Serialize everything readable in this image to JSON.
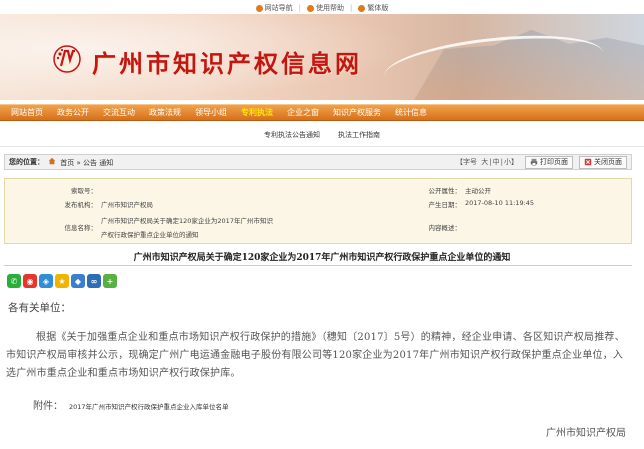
{
  "toplinks": [
    {
      "label": "网站导航"
    },
    {
      "label": "使用帮助"
    },
    {
      "label": "繁体版"
    }
  ],
  "site": {
    "title": "广州市知识产权信息网"
  },
  "nav": {
    "items": [
      {
        "label": "网站首页"
      },
      {
        "label": "政务公开"
      },
      {
        "label": "交流互动"
      },
      {
        "label": "政策法规"
      },
      {
        "label": "领导小组"
      },
      {
        "label": "专利执法"
      },
      {
        "label": "企业之窗"
      },
      {
        "label": "知识产权服务"
      },
      {
        "label": "统计信息"
      }
    ],
    "active_label": "专利执法"
  },
  "subnav": {
    "items": [
      {
        "label": "专利执法公告通知"
      },
      {
        "label": "执法工作指南"
      }
    ]
  },
  "location": {
    "label": "您的位置：",
    "home": "首页",
    "arrow1": "»",
    "category": "公告",
    "subcategory": "通知",
    "font_size_label": "【字号",
    "font_large": "大",
    "font_mid": "中",
    "font_small": "小】",
    "print_label": "打印页面",
    "close_label": "关闭页面"
  },
  "info": {
    "index_label": "索取号：",
    "index_value": "",
    "publisher_label": "发布机构：",
    "publisher_value": "广州市知识产权局",
    "name_label": "信息名称：",
    "name_value_line1": "广州市知识产权局关于确定120家企业为2017年广州市知识",
    "name_value_line2": "产权行政保护重点企业单位的通知",
    "disclosure_label": "公开属性：",
    "disclosure_value": "主动公开",
    "date_label": "产生日期：",
    "date_value": "2017-08-10 11:19:45",
    "summary_label": "内容概述："
  },
  "article": {
    "title": "广州市知识产权局关于确定120家企业为2017年广州市知识产权行政保护重点企业单位的通知",
    "salutation": "各有关单位：",
    "paragraph": "根据《关于加强重点企业和重点市场知识产权行政保护的措施》（穗知〔2017〕5号）的精神，经企业申请、各区知识产权局推荐、市知识产权局审核并公示，现确定广州广电运通金融电子股份有限公司等120家企业为2017年广州市知识产权行政保护重点企业单位，入选广州市重点企业和重点市场知识产权行政保护库。",
    "attachment_label": "附件：",
    "attachment_link": "2017年广州市知识产权行政保护重点企业入库单位名单",
    "signer": "广州市知识产权局"
  },
  "share_icons": [
    {
      "name": "wechat-icon",
      "color": "#2aae3a",
      "glyph": "✆"
    },
    {
      "name": "weibo-icon",
      "color": "#e6362a",
      "glyph": "◉"
    },
    {
      "name": "tencent-weibo-icon",
      "color": "#2f8ed6",
      "glyph": "◈"
    },
    {
      "name": "qzone-icon",
      "color": "#f0b400",
      "glyph": "★"
    },
    {
      "name": "qq-icon",
      "color": "#3a7ed1",
      "glyph": "◆"
    },
    {
      "name": "renren-icon",
      "color": "#2d6db6",
      "glyph": "∞"
    },
    {
      "name": "more-share-icon",
      "color": "#57b041",
      "glyph": "+"
    }
  ],
  "colors": {
    "brand_red": "#c41610",
    "nav_orange": "#e08226",
    "nav_active": "#ffe600"
  }
}
